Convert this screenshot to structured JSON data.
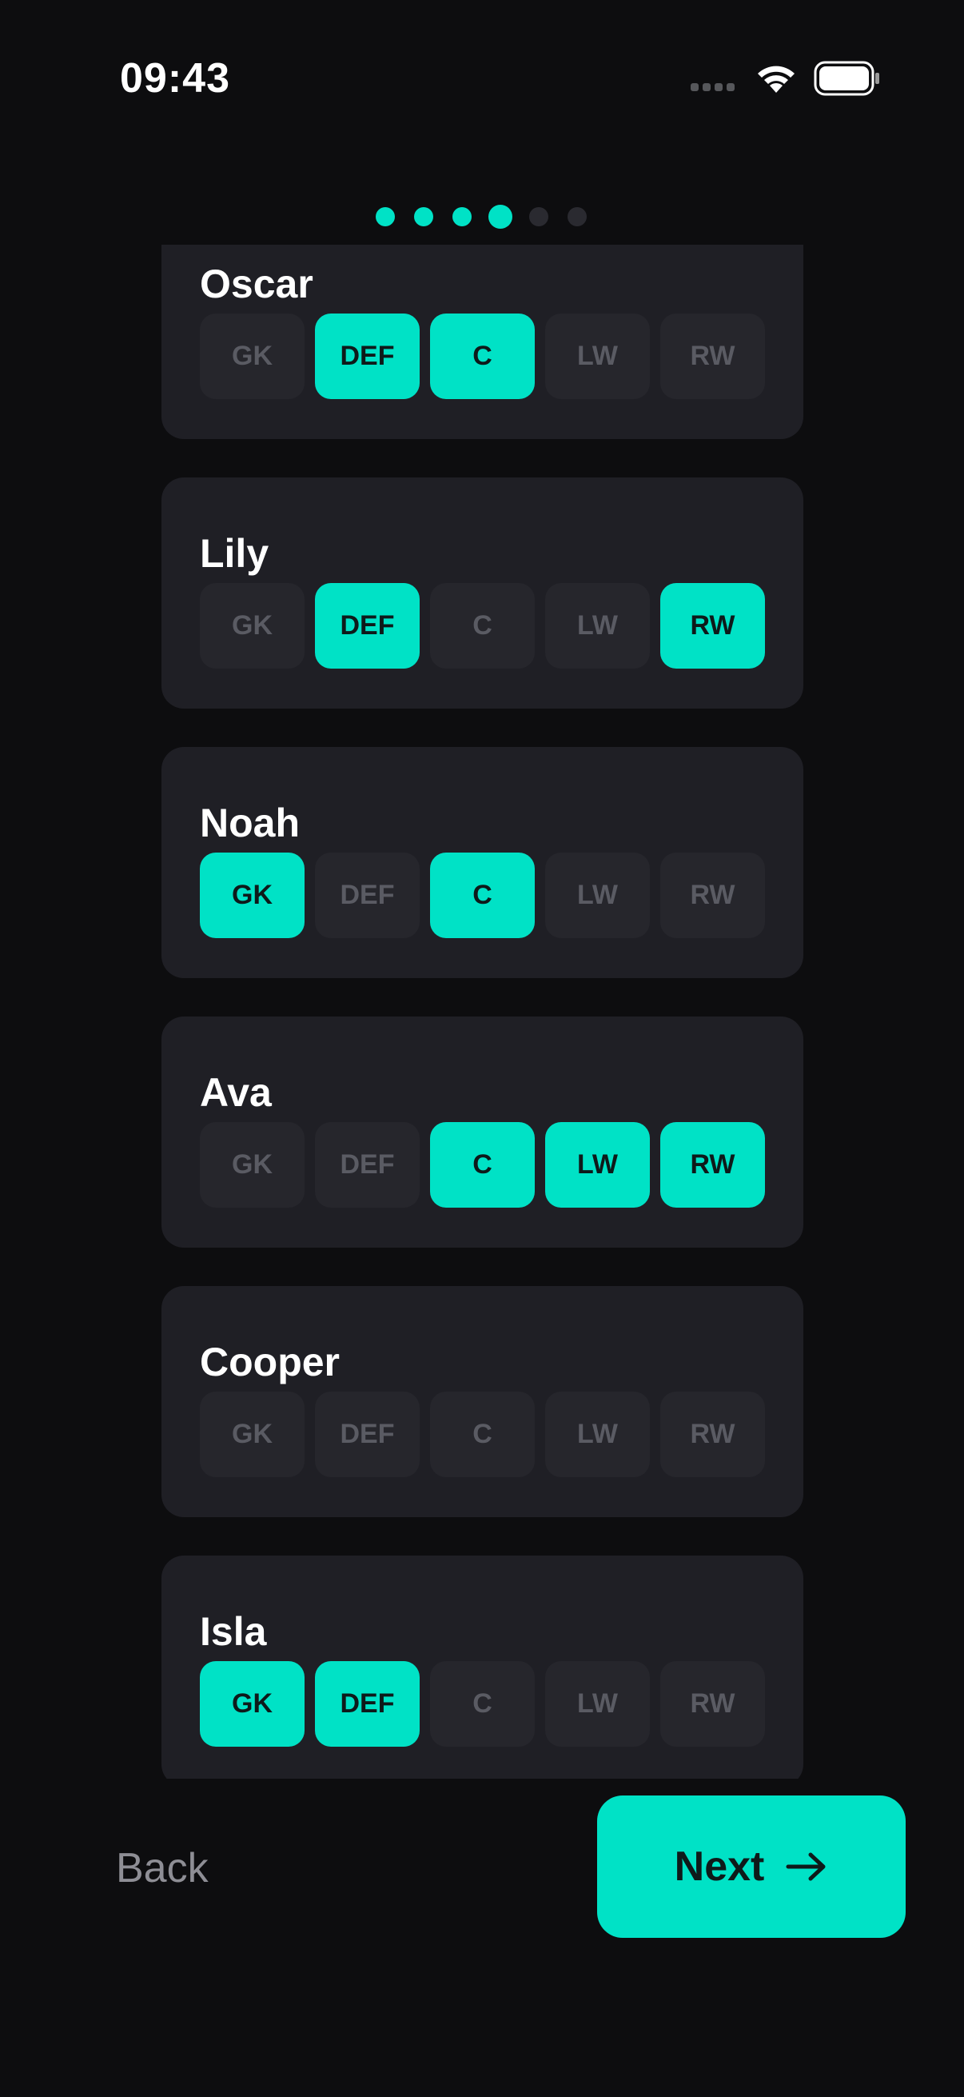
{
  "status_bar": {
    "time": "09:43"
  },
  "pagination": {
    "total": 6,
    "current": 4,
    "active_color": "#00e2c6",
    "inactive_color": "#2a2a30"
  },
  "positions": [
    "GK",
    "DEF",
    "C",
    "LW",
    "RW"
  ],
  "players": [
    {
      "name": "Oscar",
      "selected": [
        "DEF",
        "C"
      ]
    },
    {
      "name": "Lily",
      "selected": [
        "DEF",
        "RW"
      ]
    },
    {
      "name": "Noah",
      "selected": [
        "GK",
        "C"
      ]
    },
    {
      "name": "Ava",
      "selected": [
        "C",
        "LW",
        "RW"
      ]
    },
    {
      "name": "Cooper",
      "selected": []
    },
    {
      "name": "Isla",
      "selected": [
        "GK",
        "DEF"
      ]
    }
  ],
  "nav": {
    "back_label": "Back",
    "next_label": "Next"
  }
}
